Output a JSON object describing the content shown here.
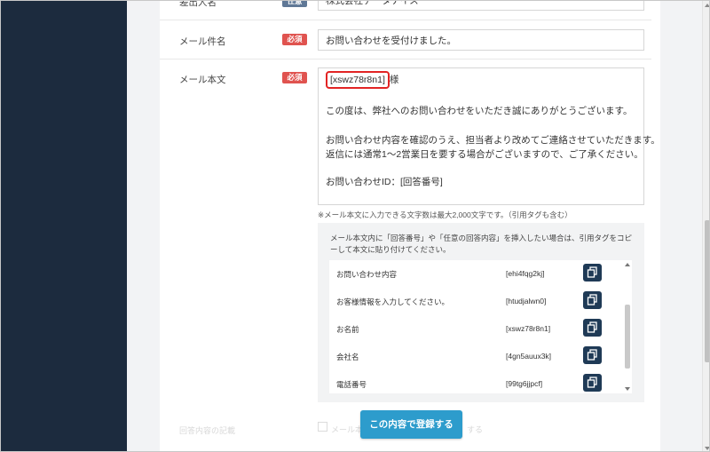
{
  "form": {
    "company_row": {
      "label": "差出人名",
      "badge": "任意",
      "value": "株式会社データナイス"
    },
    "subject_row": {
      "label": "メール件名",
      "badge": "必須",
      "value": "お問い合わせを受付けました。"
    },
    "body_row": {
      "label": "メール本文",
      "badge": "必須",
      "lines": {
        "tag": "[xswz78r8n1]",
        "honorific": "様",
        "l2": "この度は、弊社へのお問い合わせをいただき誠にありがとうございます。",
        "l3": "お問い合わせ内容を確認のうえ、担当者より改めてご連絡させていただきます。",
        "l4": "返信には通常1〜2営業日を要する場合がございますので、ご了承ください。",
        "l5": "お問い合わせID：[回答番号]"
      },
      "note": "※メール本文に入力できる文字数は最大2,000文字です。（引用タグも含む）"
    },
    "help": {
      "text": "メール本文内に「回答番号」や「任意の回答内容」を挿入したい場合は、引用タグをコピーして本文に貼り付けてください。",
      "tags": [
        {
          "name": "お問い合わせ内容",
          "code": "[ehi4fqg2kj]"
        },
        {
          "name": "お客様情報を入力してください。",
          "code": "[htudjalwn0]"
        },
        {
          "name": "お名前",
          "code": "[xswz78r8n1]"
        },
        {
          "name": "会社名",
          "code": "[4gn5auux3k]"
        },
        {
          "name": "電話番号",
          "code": "[99tg6jjpcf]"
        }
      ]
    },
    "footer": {
      "faded_label": "回答内容の記載",
      "faded_check_text": "メール本",
      "faded_check_text2": "する",
      "submit_label": "この内容で登録する"
    }
  },
  "colors": {
    "sidebar": "#1c2b3e",
    "required_badge": "#e0534f",
    "copy_button": "#1f3a56",
    "submit_button": "#2d9ccc",
    "highlight": "#e22424"
  }
}
